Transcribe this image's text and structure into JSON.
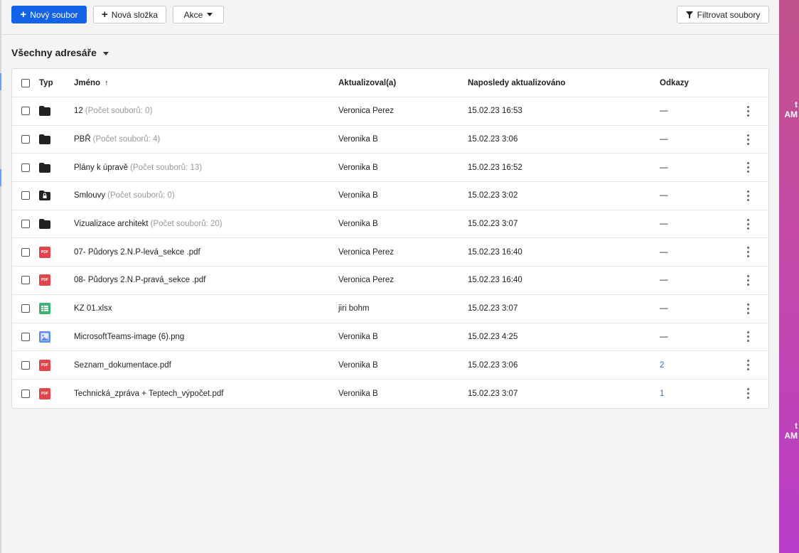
{
  "toolbar": {
    "new_file": "Nový soubor",
    "new_folder": "Nová složka",
    "actions": "Akce",
    "filter": "Filtrovat soubory"
  },
  "directory": {
    "title": "Všechny adresáře"
  },
  "table": {
    "headers": {
      "type": "Typ",
      "name": "Jméno",
      "updated_by": "Aktualizoval(a)",
      "last_updated": "Naposledy aktualizováno",
      "links": "Odkazy"
    },
    "rows": [
      {
        "icon": "folder-icon",
        "name": "12",
        "count": "(Počet souborů: 0)",
        "updated_by": "Veronica Perez",
        "date": "15.02.23 16:53",
        "links": "—"
      },
      {
        "icon": "folder-icon",
        "name": "PBŘ",
        "count": "(Počet souborů: 4)",
        "updated_by": "Veronika B",
        "date": "15.02.23 3:06",
        "links": "—"
      },
      {
        "icon": "folder-icon",
        "name": "Plány k úpravě",
        "count": "(Počet souborů: 13)",
        "updated_by": "Veronika B",
        "date": "15.02.23 16:52",
        "links": "—"
      },
      {
        "icon": "locked-folder-icon",
        "name": "Smlouvy",
        "count": "(Počet souborů: 0)",
        "updated_by": "Veronika B",
        "date": "15.02.23 3:02",
        "links": "—"
      },
      {
        "icon": "folder-icon",
        "name": "Vizualizace architekt",
        "count": "(Počet souborů: 20)",
        "updated_by": "Veronika B",
        "date": "15.02.23 3:07",
        "links": "—"
      },
      {
        "icon": "pdf-icon",
        "name": "07- Půdorys 2.N.P-levá_sekce .pdf",
        "count": "",
        "updated_by": "Veronica Perez",
        "date": "15.02.23 16:40",
        "links": "—"
      },
      {
        "icon": "pdf-icon",
        "name": "08- Půdorys 2.N.P-pravá_sekce .pdf",
        "count": "",
        "updated_by": "Veronica Perez",
        "date": "15.02.23 16:40",
        "links": "—"
      },
      {
        "icon": "spreadsheet-icon",
        "name": "KZ 01.xlsx",
        "count": "",
        "updated_by": "jiri bohm",
        "date": "15.02.23 3:07",
        "links": "—"
      },
      {
        "icon": "image-icon",
        "name": "MicrosoftTeams-image (6).png",
        "count": "",
        "updated_by": "Veronika B",
        "date": "15.02.23 4:25",
        "links": "—"
      },
      {
        "icon": "pdf-icon",
        "name": "Seznam_dokumentace.pdf",
        "count": "",
        "updated_by": "Veronika B",
        "date": "15.02.23 3:06",
        "links": "2"
      },
      {
        "icon": "pdf-icon",
        "name": "Technická_zpráva + Teptech_výpočet.pdf",
        "count": "",
        "updated_by": "Veronika B",
        "date": "15.02.23 3:07",
        "links": "1"
      }
    ]
  },
  "colors": {
    "primary": "#1362e8",
    "pdf": "#e2454b",
    "spreadsheet": "#3cb371",
    "image": "#5b8def",
    "link": "#2f6fd8",
    "desktop": "#c44aa8"
  },
  "desktop_fragments": [
    "t",
    "AM",
    "t",
    "AM"
  ]
}
